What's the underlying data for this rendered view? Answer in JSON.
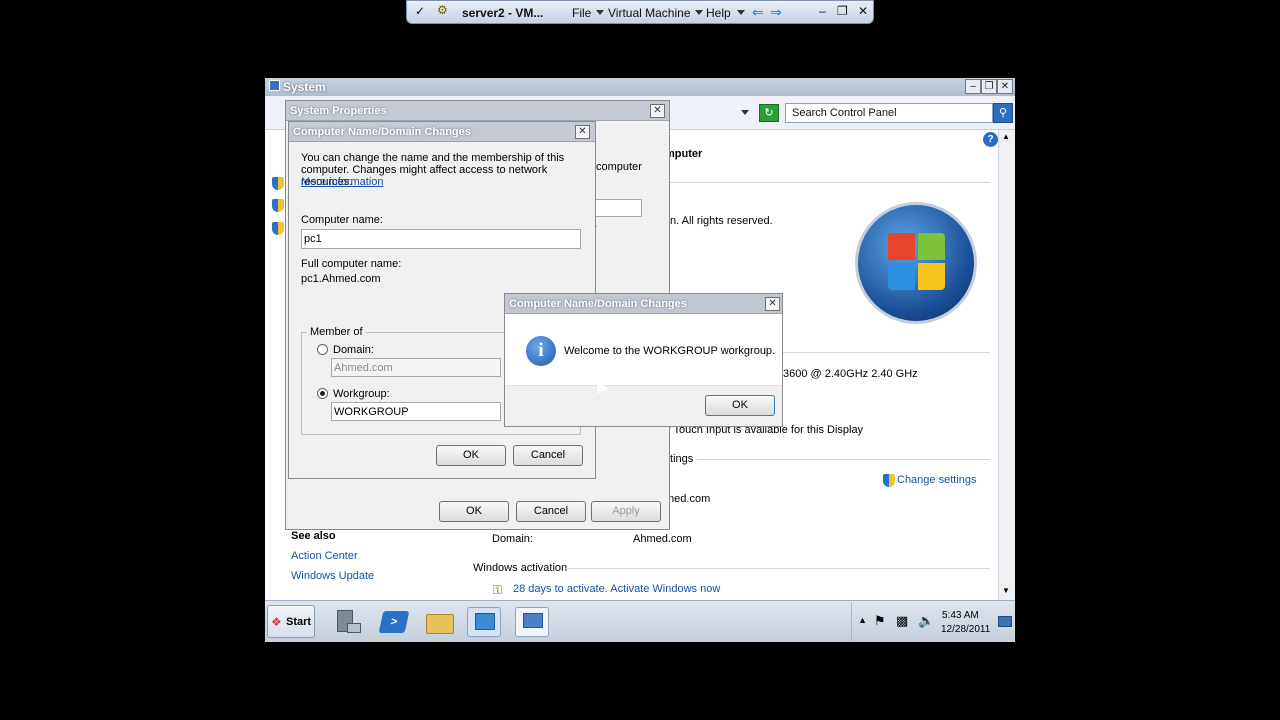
{
  "vm_toolbar": {
    "title": "server2 - VM...",
    "menus": [
      "File",
      "Virtual Machine",
      "Help"
    ]
  },
  "system_window": {
    "title": "System",
    "search_placeholder": "Search Control Panel",
    "heading_fragment": "mputer",
    "rights_fragment": "n.  All rights reserved.",
    "processor_fragment": "3600  @ 2.40GHz   2.40 GHz",
    "touch_fragment": "r Touch Input is available for this Display",
    "settings_fragment": "ttings",
    "change_settings": "Change settings",
    "name_fragment": "med.com",
    "domain_label": "Domain:",
    "domain_value": "Ahmed.com",
    "activation_header": "Windows activation",
    "activation_text": "28 days to activate. Activate Windows now",
    "see_also": "See also",
    "see_also_links": [
      "Action Center",
      "Windows Update"
    ]
  },
  "system_properties": {
    "title": "System Properties",
    "frag_computer": "computer",
    "frag_r": "r",
    "ok": "OK",
    "cancel": "Cancel",
    "apply": "Apply"
  },
  "name_changes": {
    "title": "Computer Name/Domain Changes",
    "desc": "You can change the name and the membership of this computer. Changes might affect access to network resources.",
    "more_info": "More information",
    "computer_name_label": "Computer name:",
    "computer_name_value": "pc1",
    "full_name_label": "Full computer name:",
    "full_name_value": "pc1.Ahmed.com",
    "member_of": "Member of",
    "domain_label": "Domain:",
    "domain_value": "Ahmed.com",
    "workgroup_label": "Workgroup:",
    "workgroup_value": "WORKGROUP",
    "ok": "OK",
    "cancel": "Cancel"
  },
  "welcome_dialog": {
    "title": "Computer Name/Domain Changes",
    "message": "Welcome to the WORKGROUP workgroup.",
    "ok": "OK"
  },
  "taskbar": {
    "start": "Start",
    "time": "5:43 AM",
    "date": "12/28/2011"
  }
}
